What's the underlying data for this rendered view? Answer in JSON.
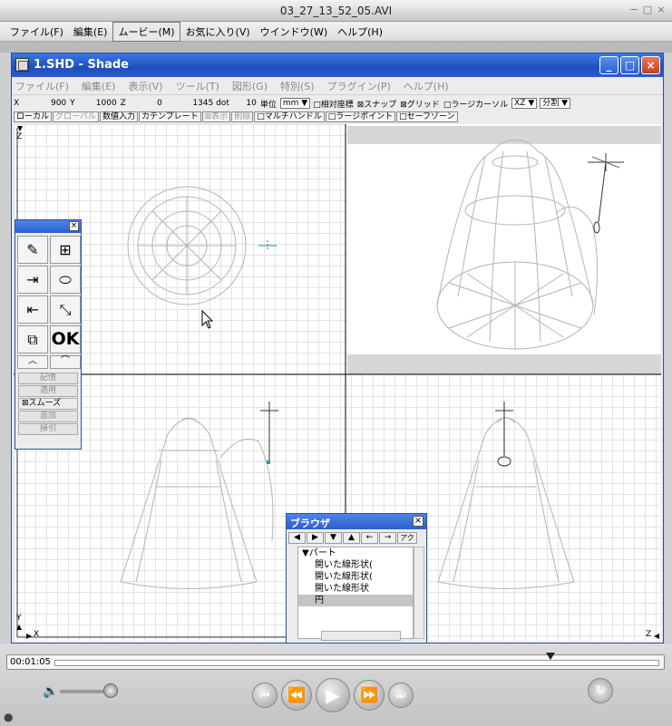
{
  "qt": {
    "title": "03_27_13_52_05.AVI",
    "window_controls": [
      "−",
      "□",
      "×"
    ],
    "menu": [
      "ファイル(F)",
      "編集(E)",
      "ムービー(M)",
      "お気に入り(V)",
      "ウインドウ(W)",
      "ヘルプ(H)"
    ],
    "active_menu_index": 2,
    "time": "00:01:05",
    "playhead_fraction": 0.82
  },
  "shade": {
    "title": "1.SHD - Shade",
    "window_controls": [
      "_",
      "□",
      "×"
    ],
    "menu": [
      "ファイル(F)",
      "編集(E)",
      "表示(V)",
      "ツール(T)",
      "図形(G)",
      "特別(S)",
      "プラグイン(P)",
      "ヘルプ(H)"
    ],
    "coords": {
      "x_label": "X",
      "x_value": "900",
      "y_label": "Y",
      "y_value": "1000",
      "z_label": "Z",
      "z_value": "0",
      "dot_value": "1345 dot",
      "unit_num": "10",
      "unit_label": "単位",
      "unit_value": "mm",
      "relative": "□相対座標",
      "snap": "⊠スナップ",
      "grid": "⊠グリッド",
      "large_cursor": "□ラージカーソル",
      "view_mode": "XZ",
      "split": "分割"
    },
    "modes": [
      {
        "label": "ローカル",
        "dim": false
      },
      {
        "label": "グローバル",
        "dim": true
      },
      {
        "label": "数値入力",
        "dim": false
      },
      {
        "label": "カテンプレート",
        "dim": false
      },
      {
        "label": "⊠表示",
        "dim": true
      },
      {
        "label": "削除",
        "dim": true
      },
      {
        "label": "□マルチハンドル",
        "dim": false
      },
      {
        "label": "□ラージポイント",
        "dim": false
      },
      {
        "label": "□セーフゾーン",
        "dim": false
      }
    ],
    "view_labels": {
      "z_top": "Z",
      "y_bottom": "Y",
      "x_bottom": "X",
      "z_right": "Z"
    }
  },
  "palette": {
    "close": "×",
    "tools": [
      {
        "glyph": "✎",
        "name": "pen-tool"
      },
      {
        "glyph": "⊞",
        "name": "hierarchy-tool"
      },
      {
        "glyph": "⇥",
        "name": "move-tool"
      },
      {
        "glyph": "⬭",
        "name": "cylinder-tool"
      },
      {
        "glyph": "⇤",
        "name": "scale-tool"
      },
      {
        "glyph": "⤡",
        "name": "line-tool"
      },
      {
        "glyph": "⧉",
        "name": "copy-tool"
      },
      {
        "glyph": "OK",
        "name": "ok-button"
      }
    ],
    "small_tools": [
      "︿",
      "⌒"
    ],
    "buttons": [
      {
        "label": "記憶",
        "on": false
      },
      {
        "label": "適用",
        "on": false
      },
      {
        "label": "⊠スムーズ",
        "on": true
      },
      {
        "label": "追加",
        "on": false
      },
      {
        "label": "掃引",
        "on": false
      }
    ]
  },
  "browser": {
    "title": "ブラウザ",
    "close": "×",
    "toolbar": [
      "◀",
      "▶",
      "▼",
      "▲",
      "←",
      "→",
      "アクティブ"
    ],
    "items": [
      {
        "label": "▼パート",
        "child": false,
        "selected": false
      },
      {
        "label": "開いた線形状(",
        "child": true,
        "selected": false
      },
      {
        "label": "開いた線形状(",
        "child": true,
        "selected": false
      },
      {
        "label": "開いた線形状",
        "child": true,
        "selected": false
      },
      {
        "label": "円",
        "child": true,
        "selected": true
      }
    ]
  },
  "player": {
    "volume_icon": "🔈",
    "buttons": [
      "⏮",
      "⏪",
      "▶",
      "⏩",
      "⏭"
    ],
    "loop_icon": "↻",
    "apple_icon": "●"
  }
}
